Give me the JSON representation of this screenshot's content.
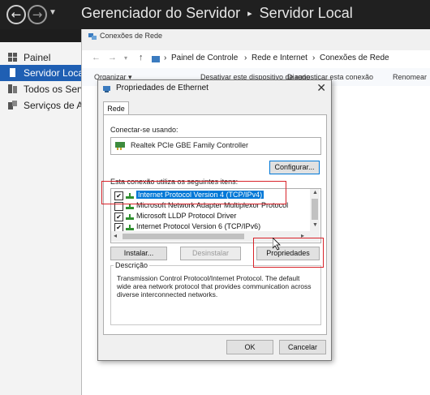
{
  "server_manager": {
    "title": "Gerenciador do Servidor",
    "separator": "▸",
    "section": "Servidor Local",
    "sidebar": [
      {
        "label": "Painel",
        "icon": "dashboard-icon"
      },
      {
        "label": "Servidor Local",
        "icon": "server-icon",
        "selected": true
      },
      {
        "label": "Todos os Servidores",
        "icon": "servers-icon"
      },
      {
        "label": "Serviços de Arquivo",
        "icon": "file-services-icon"
      }
    ]
  },
  "network_window": {
    "title": "Conexões de Rede",
    "breadcrumb": [
      "Painel de Controle",
      "Rede e Internet",
      "Conexões de Rede"
    ],
    "commands": [
      "Organizar ▾",
      "Desativar este dispositivo de rede",
      "Diagnosticar esta conexão",
      "Renomear"
    ]
  },
  "dialog": {
    "title": "Propriedades de Ethernet",
    "close": "✕",
    "tab": "Rede",
    "connect_using_label": "Conectar-se usando:",
    "adapter_name": "Realtek PCIe GBE Family Controller",
    "configure_button": "Configurar...",
    "items_label": "Esta conexão utiliza os seguintes itens:",
    "items": [
      {
        "label": "Internet Protocol Version 4 (TCP/IPv4)",
        "checked": true,
        "selected": true
      },
      {
        "label": "Microsoft Network Adapter Multiplexor Protocol",
        "checked": false
      },
      {
        "label": "Microsoft LLDP Protocol Driver",
        "checked": true
      },
      {
        "label": "Internet Protocol Version 6 (TCP/IPv6)",
        "checked": true
      }
    ],
    "install_button": "Instalar...",
    "uninstall_button": "Desinstalar",
    "properties_button": "Propriedades",
    "description_label": "Descrição",
    "description_text": "Transmission Control Protocol/Internet Protocol. The default wide area network protocol that provides communication across diverse interconnected networks.",
    "ok_button": "OK",
    "cancel_button": "Cancelar"
  },
  "colors": {
    "accent": "#0078d7",
    "highlight": "#d8232a",
    "sidebar_selected": "#1f5fb3"
  }
}
